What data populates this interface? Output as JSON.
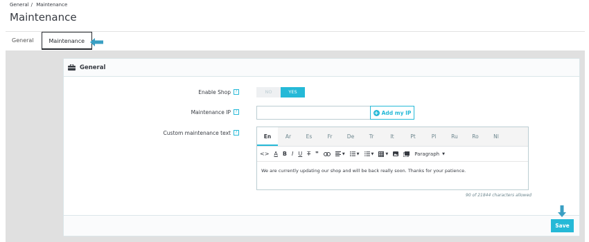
{
  "breadcrumb": {
    "first": "General",
    "separator": "/",
    "second": "Maintenance"
  },
  "page": {
    "title": "Maintenance"
  },
  "tabs": [
    {
      "label": "General"
    },
    {
      "label": "Maintenance",
      "active": true
    }
  ],
  "card": {
    "title": "General",
    "icon": "briefcase-icon",
    "fields": {
      "enable_shop": {
        "label": "Enable Shop",
        "help": "?",
        "no": "NO",
        "yes": "YES",
        "selected": "YES"
      },
      "maintenance_ip": {
        "label": "Maintenance IP",
        "help": "?",
        "value": "",
        "button": "Add my IP"
      },
      "custom_text": {
        "label": "Custom maintenance text",
        "help": "?",
        "languages": [
          "En",
          "Ar",
          "Es",
          "Fr",
          "De",
          "Tr",
          "It",
          "Pt",
          "Pl",
          "Ru",
          "Ro",
          "Nl"
        ],
        "active_language": "En",
        "toolbar": [
          "code-icon",
          "font-color-icon",
          "bold-icon",
          "italic-icon",
          "underline-icon",
          "strikethrough-icon",
          "quote-icon",
          "link-icon",
          "align-icon",
          "bullet-list-icon",
          "numbered-list-icon",
          "table-icon",
          "image-icon",
          "media-icon"
        ],
        "paragraph": "Paragraph",
        "content": "We are currently updating our shop and will be back really soon. Thanks for your patience.",
        "char_count": "90 of 21844 characters allowed"
      }
    }
  },
  "footer": {
    "save": "Save"
  },
  "colors": {
    "accent": "#25b9d7",
    "arrow": "#3a9fc3"
  }
}
